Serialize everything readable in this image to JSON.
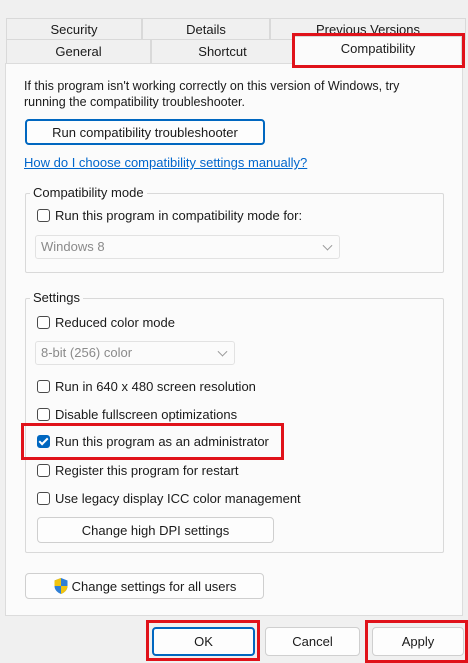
{
  "tabs": {
    "back_row": [
      "Security",
      "Details",
      "Previous Versions"
    ],
    "front_row": [
      "General",
      "Shortcut",
      "Compatibility"
    ]
  },
  "intro_line1": "If this program isn't working correctly on this version of Windows, try",
  "intro_line2": "running the compatibility troubleshooter.",
  "troubleshooter_button": "Run compatibility troubleshooter",
  "manual_link": "How do I choose compatibility settings manually?",
  "compat_mode": {
    "legend": "Compatibility mode",
    "checkbox_label": "Run this program in compatibility mode for:",
    "checked": false,
    "os_value": "Windows 8"
  },
  "settings": {
    "legend": "Settings",
    "reduced_color": "Reduced color mode",
    "color_value": "8-bit (256) color",
    "res_640": "Run in 640 x 480 screen resolution",
    "disable_fullscreen": "Disable fullscreen optimizations",
    "run_admin": "Run this program as an administrator",
    "register_restart": "Register this program for restart",
    "legacy_icc": "Use legacy display ICC color management",
    "dpi_button": "Change high DPI settings",
    "checked": {
      "reduced_color": false,
      "res_640": false,
      "disable_fullscreen": false,
      "run_admin": true,
      "register_restart": false,
      "legacy_icc": false
    }
  },
  "all_users_button": "Change settings for all users",
  "footer": {
    "ok": "OK",
    "cancel": "Cancel",
    "apply": "Apply"
  },
  "colors": {
    "highlight": "#e0121a",
    "accent": "#0067c0",
    "link": "#0066cc"
  },
  "icons": {
    "shield": "uac-shield-icon"
  }
}
